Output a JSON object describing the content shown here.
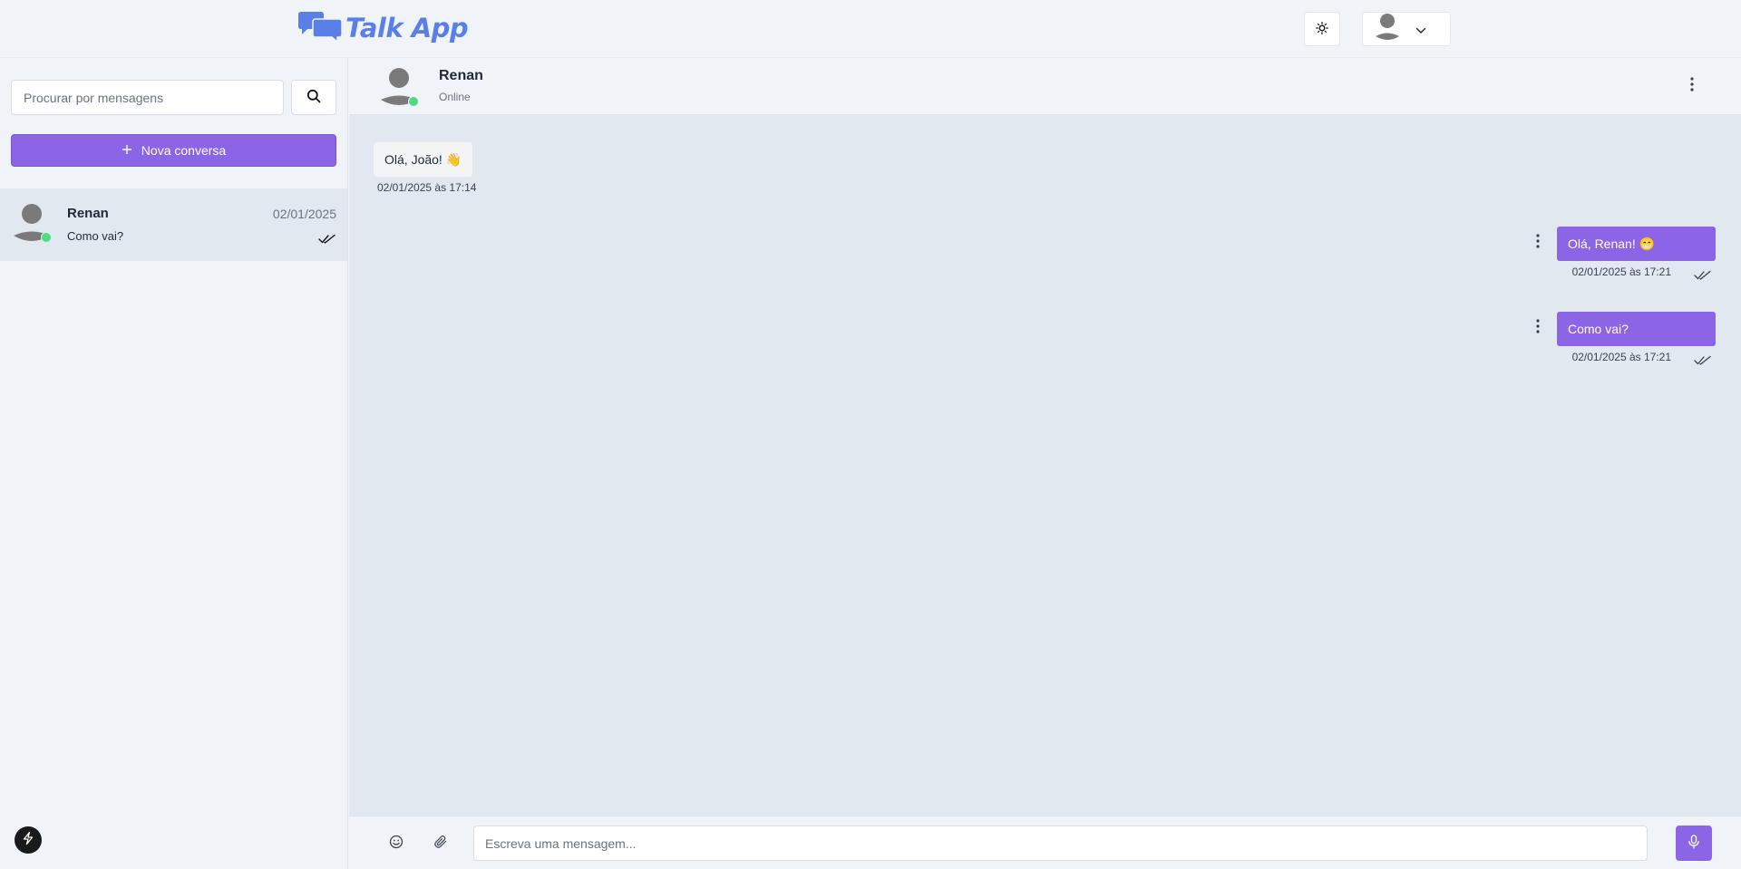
{
  "app": {
    "name": "Talk App",
    "brand_color": "#5a7fe6",
    "accent_color": "#8b65e6",
    "online_color": "#4ade80"
  },
  "header": {
    "theme_icon": "sun-icon",
    "user_icon": "user-avatar-icon",
    "dropdown_icon": "chevron-down-icon"
  },
  "sidebar": {
    "search_placeholder": "Procurar por mensagens",
    "search_icon": "search-icon",
    "new_chat_label": "Nova conversa",
    "conversations": [
      {
        "name": "Renan",
        "date": "02/01/2025",
        "last_message": "Como vai?",
        "status": "online",
        "read": true
      }
    ]
  },
  "chat": {
    "contact_name": "Renan",
    "contact_status": "Online",
    "messages": [
      {
        "direction": "in",
        "text": "Olá, João! 👋",
        "time": "02/01/2025 às 17:14"
      },
      {
        "direction": "out",
        "text": "Olá, Renan! 😁",
        "time": "02/01/2025 às 17:21",
        "read": true
      },
      {
        "direction": "out",
        "text": "Como vai?",
        "time": "02/01/2025 às 17:21",
        "read": true
      }
    ]
  },
  "composer": {
    "placeholder": "Escreva uma mensagem...",
    "emoji_icon": "emoji-icon",
    "attach_icon": "paperclip-icon",
    "mic_icon": "microphone-icon"
  }
}
